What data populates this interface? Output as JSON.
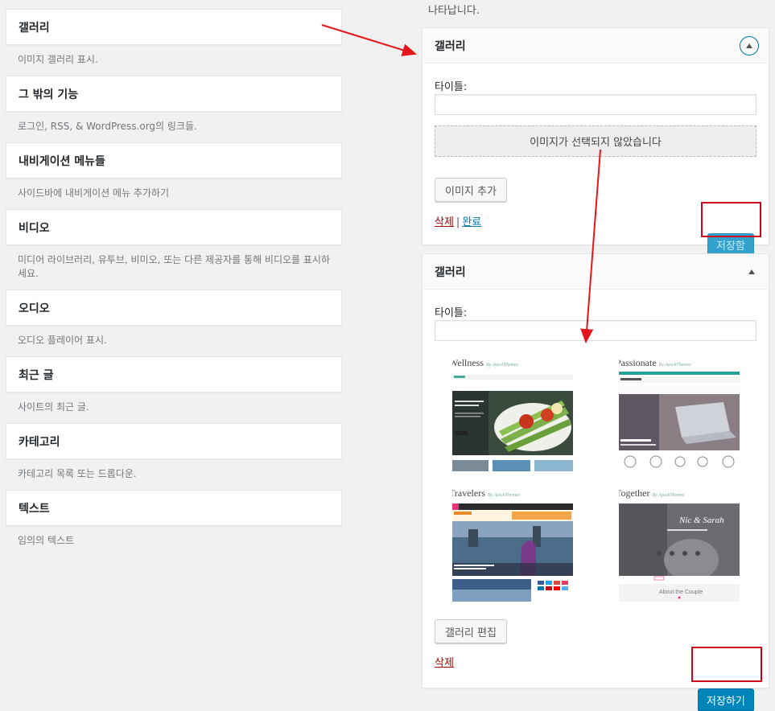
{
  "widgets": [
    {
      "title": "갤러리",
      "desc": "이미지 갤러리 표시."
    },
    {
      "title": "그 밖의 기능",
      "desc": "로그인, RSS, & WordPress.org의 링크들."
    },
    {
      "title": "내비게이션 메뉴들",
      "desc": "사이드바에 내비게이션 메뉴 추가하기"
    },
    {
      "title": "비디오",
      "desc": "미디어 라이브러리, 유투브, 비미오, 또는 다른 제공자를 통해 비디오를 표시하세요."
    },
    {
      "title": "오디오",
      "desc": "오디오 플레이어 표시."
    },
    {
      "title": "최근 글",
      "desc": "사이트의 최근 글."
    },
    {
      "title": "카테고리",
      "desc": "카테고리 목록 또는 드롭다운."
    },
    {
      "title": "텍스트",
      "desc": "임의의 텍스트"
    }
  ],
  "right_top_text": "나타납니다.",
  "panel1": {
    "title": "갤러리",
    "title_label": "타이틀:",
    "title_value": "",
    "no_image_text": "이미지가 선택되지 않았습니다",
    "add_image_button": "이미지 추가",
    "delete_link": "삭제",
    "separator": "|",
    "done_link": "완료",
    "save_button": "저장함"
  },
  "panel2": {
    "title": "갤러리",
    "title_label": "타이틀:",
    "title_value": "",
    "thumbnails": [
      {
        "title": "Wellness",
        "by": "By AyeckThemes"
      },
      {
        "title": "Passionate",
        "by": "By AyeckThemes"
      },
      {
        "title": "Travelers",
        "by": "By AyeckThemes"
      },
      {
        "title": "Together",
        "by": "By AyeckThemes"
      }
    ],
    "edit_gallery_button": "갤러리 편집",
    "delete_link": "삭제",
    "save_button": "저장하기"
  },
  "colors": {
    "accent": "#0085ba",
    "annotation_red": "#d0021b",
    "delete_red": "#aa0000"
  }
}
